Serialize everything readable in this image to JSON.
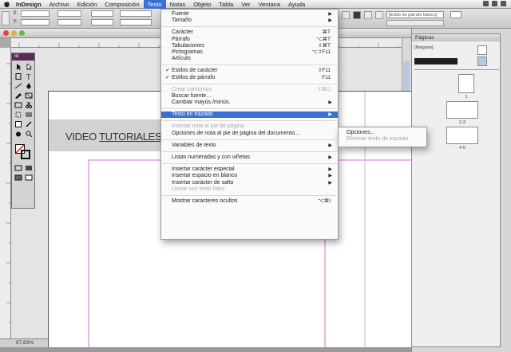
{
  "menubar": {
    "app": "InDesign",
    "items": [
      "Archivo",
      "Edición",
      "Composición",
      "Texto",
      "Notas",
      "Objeto",
      "Tabla",
      "Ver",
      "Ventana",
      "Ayuda"
    ],
    "active_index": 3
  },
  "controlbar": {
    "style_field": "[Estilo de párrafo básico]",
    "zoom": "100%"
  },
  "tools_panel": {
    "header": "Id"
  },
  "pages_panel": {
    "title": "Páginas",
    "master_label": "[Ninguno]",
    "page_numbers": [
      "1",
      "2-3",
      "4-5"
    ]
  },
  "document": {
    "banner_prefix": "VIDEO ",
    "banner_underlined": "TUTORIALES",
    "status_zoom": "67,83%",
    "status_page": "1"
  },
  "texto_menu": {
    "items": [
      {
        "label": "Fuente",
        "shortcut": "",
        "submenu": true,
        "disabled": false,
        "checked": false
      },
      {
        "label": "Tamaño",
        "shortcut": "",
        "submenu": true,
        "disabled": false,
        "checked": false
      },
      {
        "sep": true
      },
      {
        "label": "Carácter",
        "shortcut": "⌘T",
        "submenu": false,
        "disabled": false,
        "checked": false
      },
      {
        "label": "Párrafo",
        "shortcut": "⌥⌘T",
        "submenu": false,
        "disabled": false,
        "checked": false
      },
      {
        "label": "Tabulaciones",
        "shortcut": "⇧⌘T",
        "submenu": false,
        "disabled": false,
        "checked": false
      },
      {
        "label": "Pictogramas",
        "shortcut": "⌥⇧F11",
        "submenu": false,
        "disabled": false,
        "checked": false
      },
      {
        "label": "Artículo",
        "shortcut": "",
        "submenu": false,
        "disabled": false,
        "checked": false
      },
      {
        "sep": true
      },
      {
        "label": "Estilos de carácter",
        "shortcut": "⇧F11",
        "submenu": false,
        "disabled": false,
        "checked": true
      },
      {
        "label": "Estilos de párrafo",
        "shortcut": "F11",
        "submenu": false,
        "disabled": false,
        "checked": true
      },
      {
        "sep": true
      },
      {
        "label": "Crear contornos",
        "shortcut": "⇧⌘O",
        "submenu": false,
        "disabled": true,
        "checked": false
      },
      {
        "label": "Buscar fuente...",
        "shortcut": "",
        "submenu": false,
        "disabled": false,
        "checked": false
      },
      {
        "label": "Cambiar mayús./minús.",
        "shortcut": "",
        "submenu": true,
        "disabled": false,
        "checked": false
      },
      {
        "sep": true
      },
      {
        "label": "Texto en trazado",
        "shortcut": "",
        "submenu": true,
        "disabled": false,
        "checked": false,
        "highlighted": true
      },
      {
        "sep": true
      },
      {
        "label": "Insertar nota al pie de página",
        "shortcut": "",
        "submenu": false,
        "disabled": true,
        "checked": false
      },
      {
        "label": "Opciones de nota al pie de página del documento...",
        "shortcut": "",
        "submenu": false,
        "disabled": false,
        "checked": false
      },
      {
        "sep": true
      },
      {
        "label": "Variables de texto",
        "shortcut": "",
        "submenu": true,
        "disabled": false,
        "checked": false
      },
      {
        "sep": true
      },
      {
        "label": "Listas numeradas y con viñetas",
        "shortcut": "",
        "submenu": true,
        "disabled": false,
        "checked": false
      },
      {
        "sep": true
      },
      {
        "label": "Insertar carácter especial",
        "shortcut": "",
        "submenu": true,
        "disabled": false,
        "checked": false
      },
      {
        "label": "Insertar espacio en blanco",
        "shortcut": "",
        "submenu": true,
        "disabled": false,
        "checked": false
      },
      {
        "label": "Insertar carácter de salto",
        "shortcut": "",
        "submenu": true,
        "disabled": false,
        "checked": false
      },
      {
        "label": "Llenar con texto falso",
        "shortcut": "",
        "submenu": false,
        "disabled": true,
        "checked": false
      },
      {
        "sep": true
      },
      {
        "label": "Mostrar caracteres ocultos",
        "shortcut": "⌥⌘I",
        "submenu": false,
        "disabled": false,
        "checked": false
      }
    ]
  },
  "submenu": {
    "items": [
      {
        "label": "Opciones...",
        "disabled": false
      },
      {
        "label": "Eliminar texto de trazado",
        "disabled": true
      }
    ]
  }
}
